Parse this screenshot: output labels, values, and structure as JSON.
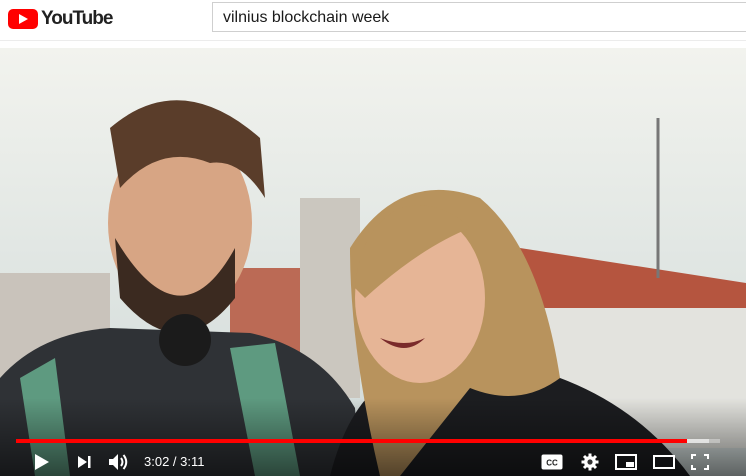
{
  "header": {
    "logo_text": "YouTube",
    "search_value": "vilnius blockchain week"
  },
  "player": {
    "current_time": "3:02",
    "separator": " / ",
    "duration": "3:11",
    "progress_fraction": 0.953,
    "loaded_fraction": 0.985,
    "accent_color": "#ff0000",
    "cc_label": "CC"
  },
  "icons": [
    "play-icon",
    "next-icon",
    "volume-icon",
    "captions-icon",
    "settings-icon",
    "miniplayer-icon",
    "theater-icon",
    "fullscreen-icon"
  ]
}
